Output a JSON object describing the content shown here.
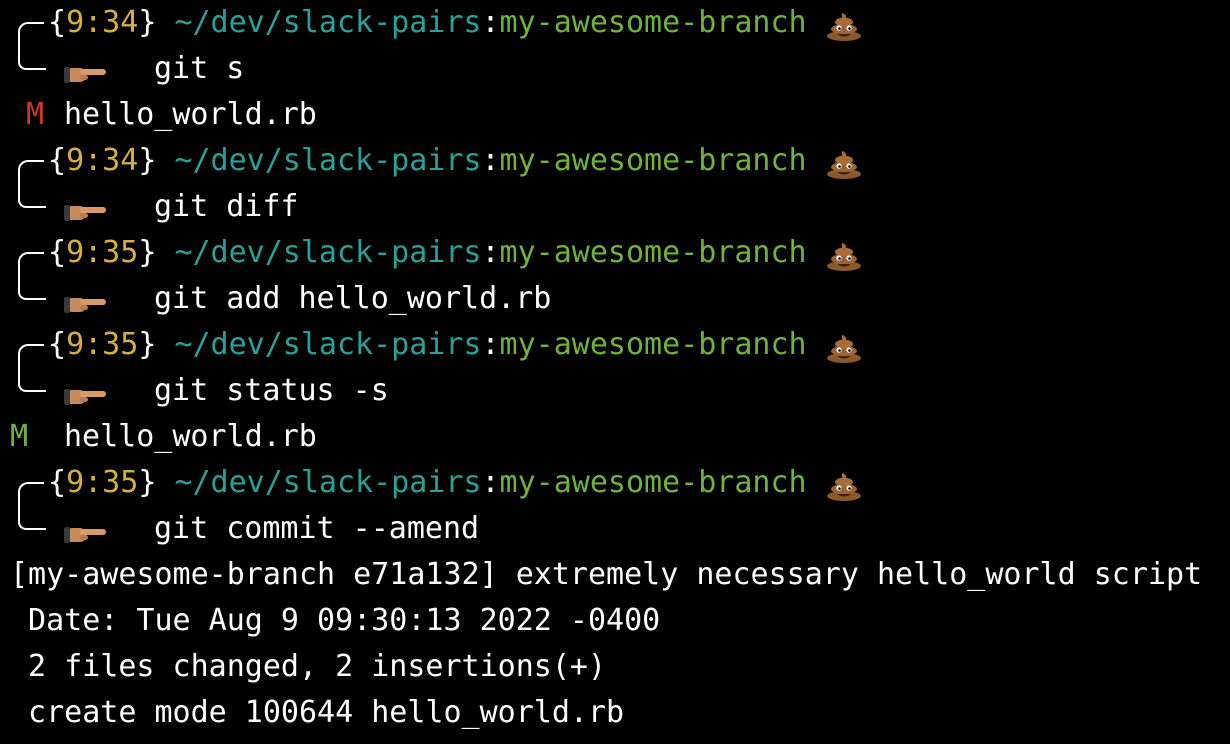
{
  "prompts": [
    {
      "time": "9:34",
      "path": "~/dev/slack-pairs",
      "branch": "my-awesome-branch",
      "command": "git s"
    },
    {
      "time": "9:34",
      "path": "~/dev/slack-pairs",
      "branch": "my-awesome-branch",
      "command": "git diff"
    },
    {
      "time": "9:35",
      "path": "~/dev/slack-pairs",
      "branch": "my-awesome-branch",
      "command": "git add hello_world.rb"
    },
    {
      "time": "9:35",
      "path": "~/dev/slack-pairs",
      "branch": "my-awesome-branch",
      "command": "git status -s"
    },
    {
      "time": "9:35",
      "path": "~/dev/slack-pairs",
      "branch": "my-awesome-branch",
      "command": "git commit --amend"
    }
  ],
  "outputs": {
    "status1": {
      "flag": "M",
      "file": "hello_world.rb"
    },
    "status2": {
      "flag": "M",
      "file": "hello_world.rb"
    },
    "commit_header": "[my-awesome-branch e71a132] extremely necessary hello_world script",
    "commit_date": " Date: Tue Aug 9 09:30:13 2022 -0400",
    "commit_stats": " 2 files changed, 2 insertions(+)",
    "commit_mode": " create mode 100644 hello_world.rb"
  },
  "icons": {
    "branch_marker": "pile-of-poo-icon",
    "prompt_marker": "pointing-hand-icon"
  },
  "colors": {
    "background": "#000000",
    "time": "#d5b13b",
    "path": "#2aa198",
    "branch": "#6fb33c",
    "modified_unstaged": "#d4322c",
    "modified_staged": "#6fb33c"
  }
}
